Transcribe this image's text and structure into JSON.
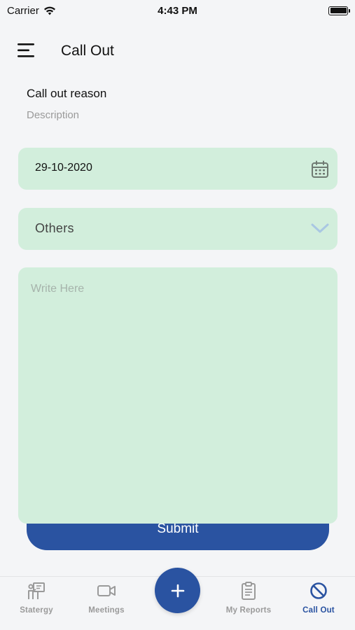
{
  "status_bar": {
    "carrier": "Carrier",
    "time": "4:43 PM"
  },
  "header": {
    "title": "Call Out"
  },
  "section": {
    "title": "Call out reason",
    "description": "Description"
  },
  "form": {
    "date_value": "29-10-2020",
    "reason_selected": "Others",
    "details_placeholder": "Write Here",
    "submit_label": "Submit"
  },
  "bottom_nav": {
    "items": [
      {
        "label": "Statergy",
        "icon": "presentation-icon",
        "active": false
      },
      {
        "label": "Meetings",
        "icon": "video-camera-icon",
        "active": false
      },
      {
        "label": "My Reports",
        "icon": "clipboard-icon",
        "active": false
      },
      {
        "label": "Call Out",
        "icon": "prohibited-icon",
        "active": true
      }
    ],
    "fab_icon": "plus-icon"
  },
  "colors": {
    "primary": "#2a53a1",
    "field_bg": "#d2eedc",
    "background": "#f4f5f7",
    "inactive_nav": "#9a9a9a"
  }
}
